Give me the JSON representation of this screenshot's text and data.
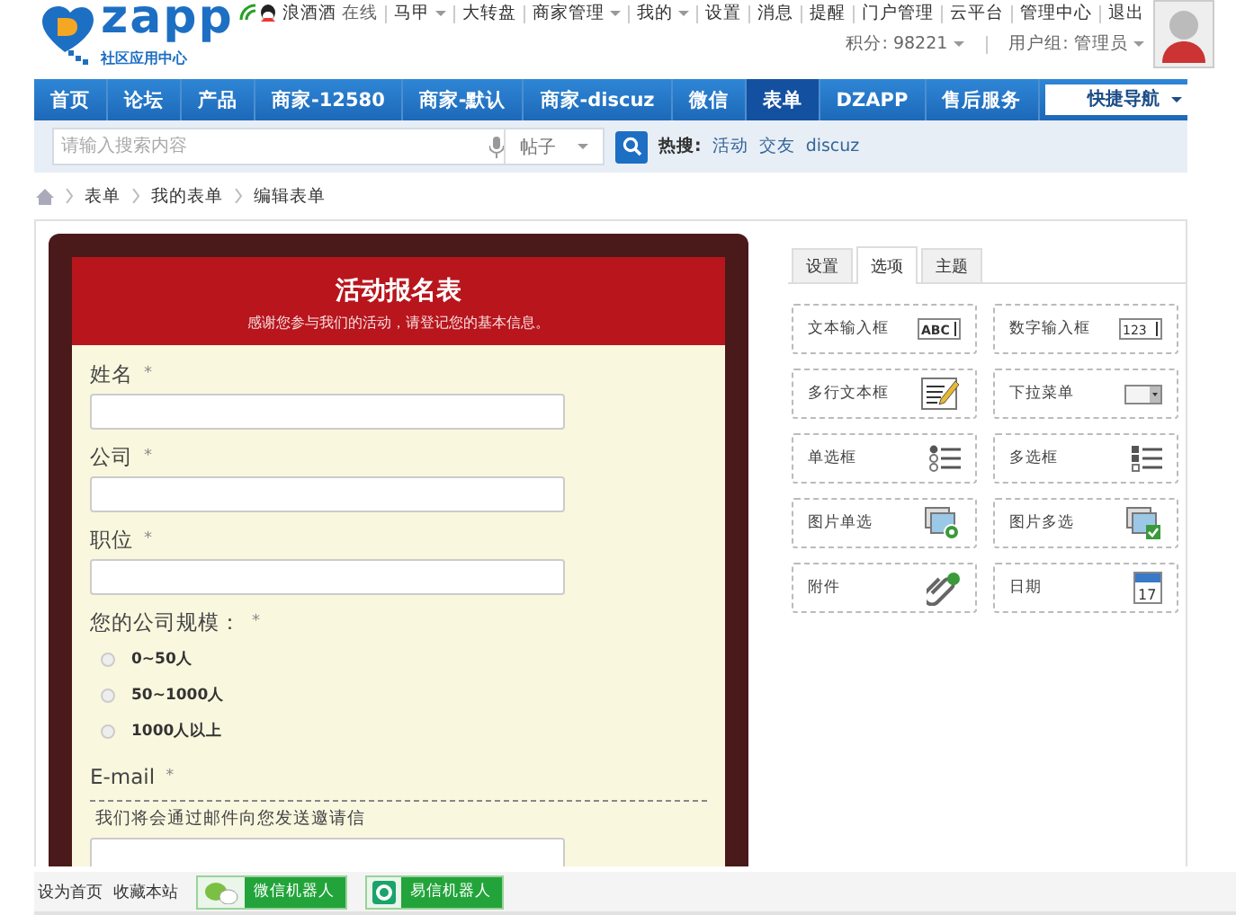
{
  "header": {
    "logo": {
      "name": "zapp",
      "tagline": "社区应用中心"
    },
    "user": {
      "name": "浪酒酒",
      "status": "在线"
    },
    "links": [
      {
        "label": "马甲",
        "dropdown": true
      },
      {
        "label": "大转盘",
        "dropdown": false
      },
      {
        "label": "商家管理",
        "dropdown": true
      },
      {
        "label": "我的",
        "dropdown": true
      },
      {
        "label": "设置",
        "dropdown": false
      },
      {
        "label": "消息",
        "dropdown": false
      },
      {
        "label": "提醒",
        "dropdown": false
      },
      {
        "label": "门户管理",
        "dropdown": false
      },
      {
        "label": "云平台",
        "dropdown": false
      },
      {
        "label": "管理中心",
        "dropdown": false
      },
      {
        "label": "退出",
        "dropdown": false
      }
    ],
    "stats": [
      {
        "label": "积分: 98221",
        "dropdown": true
      },
      {
        "label": "用户组: 管理员",
        "dropdown": true
      }
    ]
  },
  "nav": {
    "items": [
      {
        "label": "首页",
        "selected": false
      },
      {
        "label": "论坛",
        "selected": false
      },
      {
        "label": "产品",
        "selected": false
      },
      {
        "label": "商家-12580",
        "selected": false
      },
      {
        "label": "商家-默认",
        "selected": false
      },
      {
        "label": "商家-discuz",
        "selected": false
      },
      {
        "label": "微信",
        "selected": false
      },
      {
        "label": "表单",
        "selected": true
      },
      {
        "label": "DZAPP",
        "selected": false
      },
      {
        "label": "售后服务",
        "selected": false
      }
    ],
    "quick_nav": "快捷导航"
  },
  "search": {
    "placeholder": "请输入搜索内容",
    "scope": "帖子",
    "hot_label": "热搜:",
    "hot": [
      "活动",
      "交友",
      "discuz"
    ]
  },
  "breadcrumb": [
    "表单",
    "我的表单",
    "编辑表单"
  ],
  "form": {
    "title": "活动报名表",
    "subtitle": "感谢您参与我们的活动，请登记您的基本信息。",
    "fields": [
      {
        "kind": "text",
        "label": "姓名",
        "mark": "*"
      },
      {
        "kind": "text",
        "label": "公司",
        "mark": "*"
      },
      {
        "kind": "text",
        "label": "职位",
        "mark": "*"
      },
      {
        "kind": "radio",
        "label": "您的公司规模：",
        "mark": "*",
        "options": [
          {
            "label": "0~50人",
            "selected": false
          },
          {
            "label": "50~1000人",
            "selected": false
          },
          {
            "label": "1000人以上",
            "selected": false
          }
        ]
      },
      {
        "kind": "text",
        "label": "E-mail",
        "mark": "*",
        "hint": "我们将会通过邮件向您发送邀请信"
      }
    ]
  },
  "palette": {
    "tabs": [
      {
        "label": "设置",
        "selected": false
      },
      {
        "label": "选项",
        "selected": true
      },
      {
        "label": "主题",
        "selected": false
      }
    ],
    "items": [
      {
        "label": "文本输入框",
        "kind": "abc",
        "glyph": "ABC"
      },
      {
        "label": "数字输入框",
        "kind": "number",
        "glyph": "123"
      },
      {
        "label": "多行文本框",
        "kind": "textarea"
      },
      {
        "label": "下拉菜单",
        "kind": "select"
      },
      {
        "label": "单选框",
        "kind": "radio"
      },
      {
        "label": "多选框",
        "kind": "checkbox"
      },
      {
        "label": "图片单选",
        "kind": "image-radio"
      },
      {
        "label": "图片多选",
        "kind": "image-check"
      },
      {
        "label": "附件",
        "kind": "attach"
      },
      {
        "label": "日期",
        "kind": "date",
        "glyph": "17"
      }
    ]
  },
  "footer": {
    "links": [
      "设为首页",
      "收藏本站"
    ],
    "bots": [
      {
        "label": "微信机器人",
        "kind": "wechat"
      },
      {
        "label": "易信机器人",
        "kind": "yixin"
      }
    ]
  }
}
